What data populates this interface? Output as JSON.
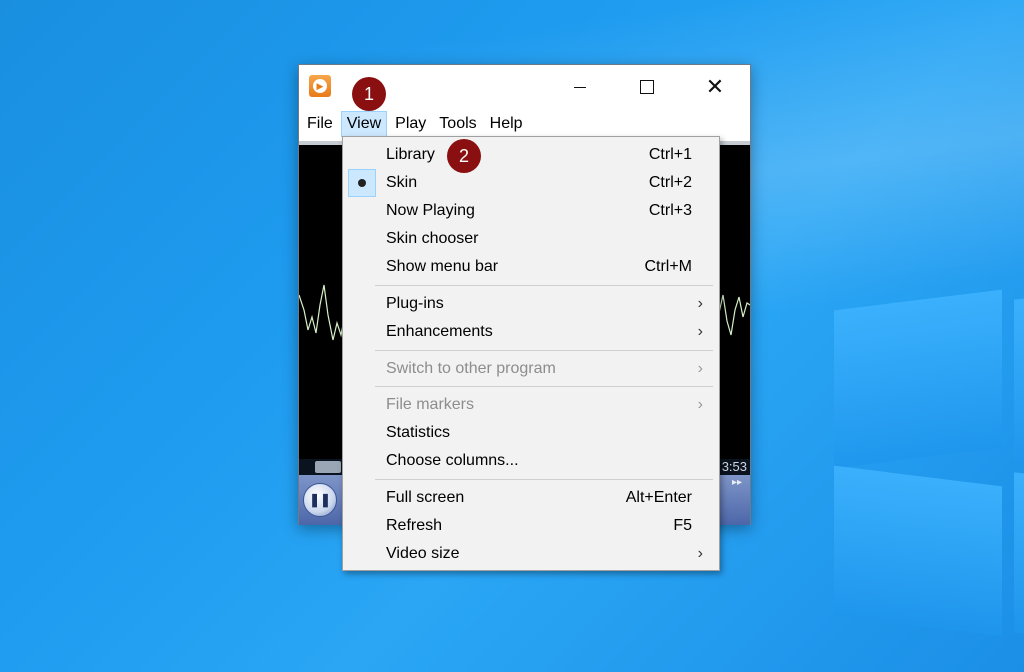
{
  "menubar": {
    "items": [
      "File",
      "View",
      "Play",
      "Tools",
      "Help"
    ]
  },
  "badges": {
    "one": "1",
    "two": "2"
  },
  "view_menu": {
    "library": {
      "label": "Library",
      "shortcut": "Ctrl+1"
    },
    "skin": {
      "label": "Skin",
      "shortcut": "Ctrl+2"
    },
    "now_playing": {
      "label": "Now Playing",
      "shortcut": "Ctrl+3"
    },
    "skin_chooser": {
      "label": "Skin chooser"
    },
    "show_menu_bar": {
      "label": "Show menu bar",
      "shortcut": "Ctrl+M"
    },
    "plugins": {
      "label": "Plug-ins"
    },
    "enhancements": {
      "label": "Enhancements"
    },
    "switch_program": {
      "label": "Switch to other program"
    },
    "file_markers": {
      "label": "File markers"
    },
    "statistics": {
      "label": "Statistics"
    },
    "choose_columns": {
      "label": "Choose columns..."
    },
    "full_screen": {
      "label": "Full screen",
      "shortcut": "Alt+Enter"
    },
    "refresh": {
      "label": "Refresh",
      "shortcut": "F5"
    },
    "video_size": {
      "label": "Video size"
    }
  },
  "player": {
    "time": "3:53"
  },
  "colors": {
    "badge": "#8a0f10",
    "menu_highlight": "#cce8ff",
    "viz_line": "#d6f0c8"
  }
}
